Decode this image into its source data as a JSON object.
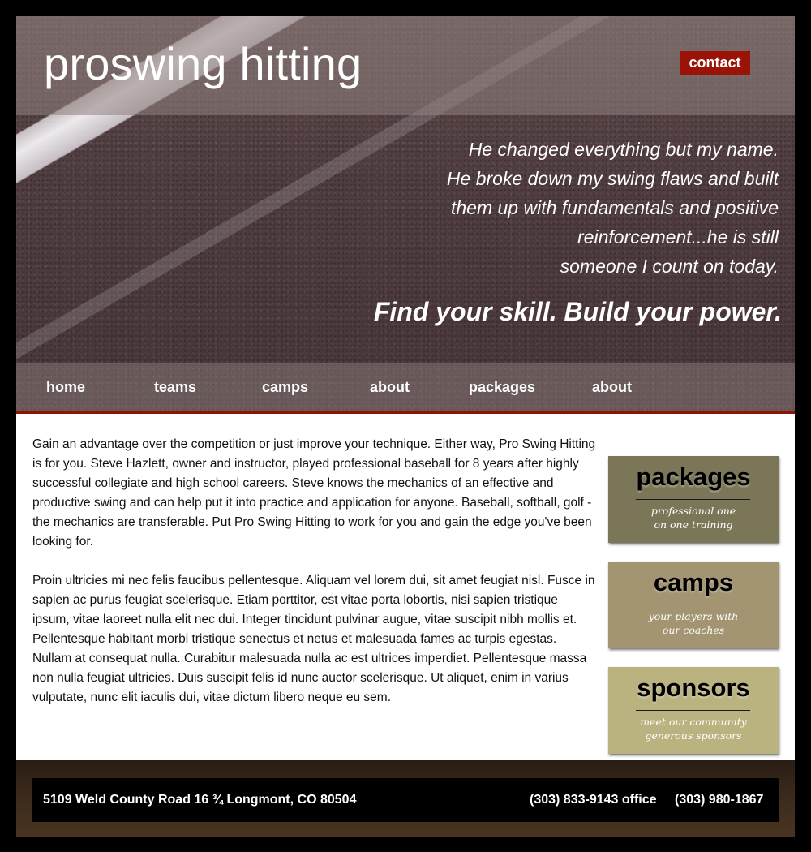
{
  "site": {
    "brand": "proswing hitting",
    "contact_label": "contact"
  },
  "hero": {
    "quote_lines": [
      "He changed everything but my name.",
      "He broke down my swing flaws and built",
      "them up with fundamentals and positive",
      "reinforcement...he is still",
      "someone I count on today."
    ],
    "tagline": "Find your skill.  Build your power."
  },
  "nav": {
    "items": [
      "home",
      "teams",
      "camps",
      "about",
      "packages",
      "about"
    ]
  },
  "main": {
    "paragraphs": [
      "Gain an advantage over the competition or just improve your technique. Either way, Pro Swing Hitting is for you. Steve Hazlett, owner and instructor, played professional baseball for 8 years after highly successful collegiate and high school careers. Steve knows the mechanics of an effective and productive swing and can help put it into practice and application for anyone. Baseball, softball, golf - the mechanics are transferable. Put Pro Swing Hitting to work for you and gain the edge you've been looking for.",
      "Proin ultricies mi nec felis faucibus pellentesque. Aliquam vel lorem dui, sit amet feugiat nisl. Fusce in sapien ac purus feugiat scelerisque. Etiam porttitor, est vitae porta lobortis, nisi sapien tristique ipsum, vitae laoreet nulla elit nec dui. Integer tincidunt pulvinar augue, vitae suscipit nibh mollis et. Pellentesque habitant morbi tristique senectus et netus et malesuada fames ac turpis egestas. Nullam at consequat nulla. Curabitur malesuada nulla ac est ultrices imperdiet. Pellentesque massa non nulla feugiat ultricies. Duis suscipit felis id nunc auctor scelerisque. Ut aliquet, enim in varius vulputate, nunc elit iaculis dui, vitae dictum libero neque eu sem."
    ]
  },
  "sidebar": {
    "cards": [
      {
        "title": "packages",
        "sub": [
          "professional one",
          "on one training"
        ],
        "color": "#7b7657"
      },
      {
        "title": "camps",
        "sub": [
          "your players with",
          "our coaches"
        ],
        "color": "#a39472"
      },
      {
        "title": "sponsors",
        "sub": [
          "meet our community",
          "generous sponsors"
        ],
        "color": "#bab27f"
      }
    ]
  },
  "footer": {
    "address": "5109 Weld County Road 16 ¾ Longmont, CO 80504",
    "phone_office": "(303) 833-9143 office",
    "phone_other": "(303) 980-1867"
  },
  "colors": {
    "accent_red": "#9b1306",
    "page_bg": "#000000"
  }
}
